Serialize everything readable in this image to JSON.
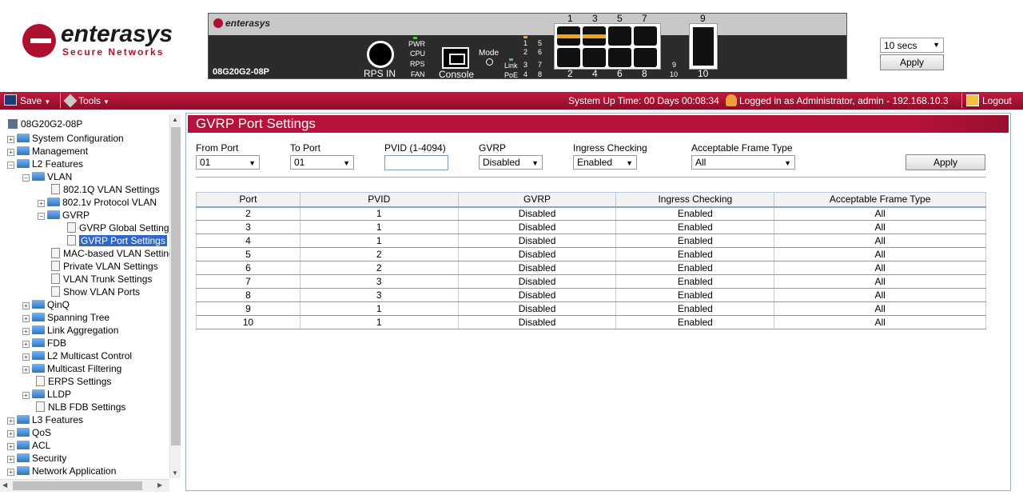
{
  "header": {
    "logo_word": "enterasys",
    "logo_tag": "Secure Networks",
    "device_brand": "enterasys",
    "device_model": "08G20G2-08P",
    "rps_label": "RPS IN",
    "console_label": "Console",
    "mode_label": "Mode",
    "status_labels": [
      "PWR",
      "CPU",
      "RPS",
      "FAN"
    ],
    "link_label": "Link",
    "poe_label": "PoE",
    "led_numbers_a": [
      "1",
      "2",
      "3",
      "4"
    ],
    "led_numbers_b": [
      "5",
      "6",
      "7",
      "8"
    ],
    "led_numbers_c": [
      "9",
      "10"
    ],
    "port_top_labels": [
      "1",
      "3",
      "5",
      "7",
      "9"
    ],
    "port_bottom_labels": [
      "2",
      "4",
      "6",
      "8",
      "10"
    ],
    "refresh_value": "10 secs",
    "apply_label": "Apply"
  },
  "toolbar": {
    "save_label": "Save",
    "tools_label": "Tools",
    "uptime": "System Up Time: 00 Days 00:08:34",
    "logged_in": "Logged in as Administrator, admin - 192.168.10.3",
    "logout_label": "Logout"
  },
  "tree": {
    "root": "08G20G2-08P",
    "items": [
      "System Configuration",
      "Management",
      "L2 Features",
      "VLAN",
      "802.1Q VLAN Settings",
      "802.1v Protocol VLAN",
      "GVRP",
      "GVRP Global Settings",
      "GVRP Port Settings",
      "MAC-based VLAN Settings",
      "Private VLAN Settings",
      "VLAN Trunk Settings",
      "Show VLAN Ports",
      "QinQ",
      "Spanning Tree",
      "Link Aggregation",
      "FDB",
      "L2 Multicast Control",
      "Multicast Filtering",
      "ERPS Settings",
      "LLDP",
      "NLB FDB Settings",
      "L3 Features",
      "QoS",
      "ACL",
      "Security",
      "Network Application"
    ]
  },
  "page": {
    "title": "GVRP Port Settings",
    "from_port_label": "From Port",
    "from_port_value": "01",
    "to_port_label": "To Port",
    "to_port_value": "01",
    "pvid_label": "PVID (1-4094)",
    "pvid_value": "",
    "gvrp_label": "GVRP",
    "gvrp_value": "Disabled",
    "ingress_label": "Ingress Checking",
    "ingress_value": "Enabled",
    "aft_label": "Acceptable Frame Type",
    "aft_value": "All",
    "apply_label": "Apply"
  },
  "table": {
    "headers": [
      "Port",
      "PVID",
      "GVRP",
      "Ingress Checking",
      "Acceptable Frame Type"
    ],
    "rows": [
      [
        "2",
        "1",
        "Disabled",
        "Enabled",
        "All"
      ],
      [
        "3",
        "1",
        "Disabled",
        "Enabled",
        "All"
      ],
      [
        "4",
        "1",
        "Disabled",
        "Enabled",
        "All"
      ],
      [
        "5",
        "2",
        "Disabled",
        "Enabled",
        "All"
      ],
      [
        "6",
        "2",
        "Disabled",
        "Enabled",
        "All"
      ],
      [
        "7",
        "3",
        "Disabled",
        "Enabled",
        "All"
      ],
      [
        "8",
        "3",
        "Disabled",
        "Enabled",
        "All"
      ],
      [
        "9",
        "1",
        "Disabled",
        "Enabled",
        "All"
      ],
      [
        "10",
        "1",
        "Disabled",
        "Enabled",
        "All"
      ]
    ]
  },
  "colors": {
    "brand_red": "#b7133a",
    "selection_blue": "#3168c5",
    "port_amber": "#f2a21b"
  }
}
